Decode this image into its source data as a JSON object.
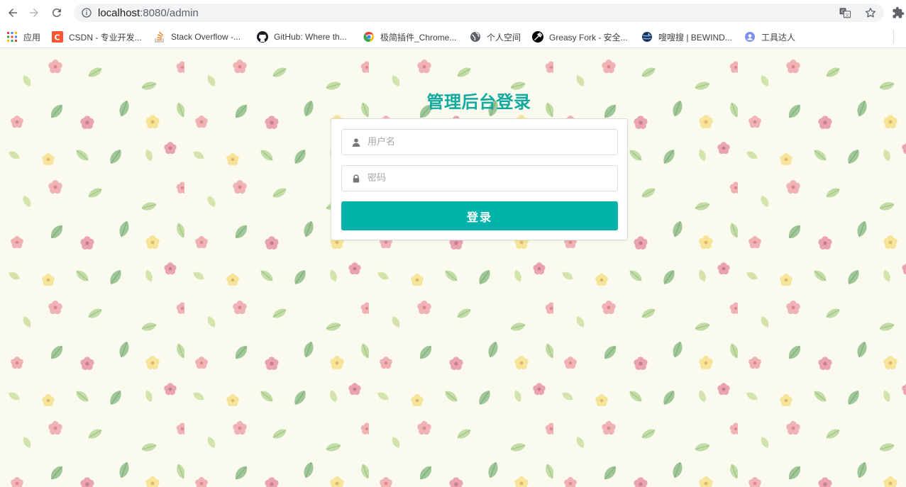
{
  "browser": {
    "url_host": "localhost",
    "url_rest": ":8080/admin"
  },
  "bookmarks": [
    {
      "label": "应用",
      "icon": "apps-grid-icon"
    },
    {
      "label": "CSDN - 专业开发...",
      "icon": "csdn-icon"
    },
    {
      "label": "Stack Overflow -...",
      "icon": "stackoverflow-icon"
    },
    {
      "label": "GitHub: Where th...",
      "icon": "github-icon"
    },
    {
      "label": "极简插件_Chrome...",
      "icon": "chrome-icon"
    },
    {
      "label": "个人空间",
      "icon": "globe-icon"
    },
    {
      "label": "Greasy Fork - 安全...",
      "icon": "greasyfork-icon"
    },
    {
      "label": "嗖嗖搜 | BEWIND...",
      "icon": "planet-icon"
    },
    {
      "label": "工具达人",
      "icon": "tool-icon"
    }
  ],
  "login": {
    "title": "管理后台登录",
    "username_placeholder": "用户名",
    "password_placeholder": "密码",
    "submit_label": "登录"
  },
  "colors": {
    "accent": "#00b3aa",
    "title": "#12aaa0",
    "page_bg": "#fbfaee"
  }
}
